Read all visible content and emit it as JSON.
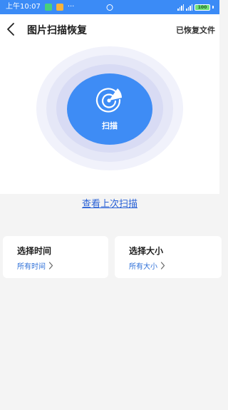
{
  "status_bar": {
    "time": "上午10:07",
    "battery": "100"
  },
  "header": {
    "title": "图片扫描恢复",
    "recovered_files": "已恢复文件"
  },
  "scan": {
    "label": "扫描"
  },
  "view_last_scan": "查看上次扫描",
  "filters": {
    "time": {
      "title": "选择时间",
      "value": "所有时间"
    },
    "size": {
      "title": "选择大小",
      "value": "所有大小"
    }
  },
  "colors": {
    "status_bar": "#3b8bf6",
    "accent": "#3e8cf5",
    "link": "#2a62d6"
  },
  "icons": [
    "back-arrow-icon",
    "radar-icon",
    "chevron-right-icon"
  ]
}
